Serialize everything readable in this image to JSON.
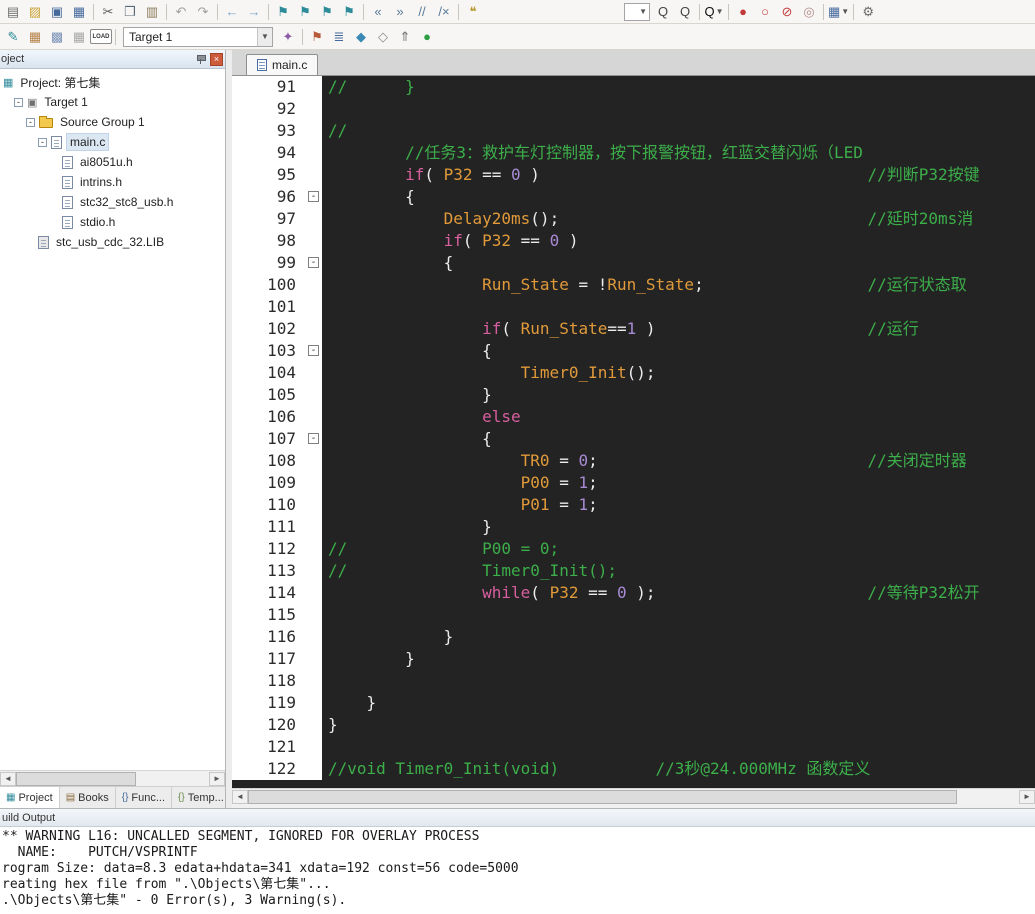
{
  "theme": {
    "editor_bg": "#232323",
    "comment": "#3cae4a",
    "keyword": "#d85f9f",
    "ident": "#e09a3a",
    "number": "#a88bd4",
    "plain": "#ececec",
    "accent": "#4a6fa5"
  },
  "toolbar_main": {
    "icons": [
      {
        "n": "new-file-icon",
        "g": "▤",
        "c": "#6e6e6e"
      },
      {
        "n": "open-file-icon",
        "g": "▨",
        "c": "#caa53d"
      },
      {
        "n": "save-icon",
        "g": "▣",
        "c": "#46699c"
      },
      {
        "n": "save-all-icon",
        "g": "▦",
        "c": "#46699c"
      },
      {
        "sep": 1
      },
      {
        "n": "cut-icon",
        "g": "✂",
        "c": "#5a5a5a"
      },
      {
        "n": "copy-icon",
        "g": "❒",
        "c": "#5a6a7a"
      },
      {
        "n": "paste-icon",
        "g": "▥",
        "c": "#8a7a5a"
      },
      {
        "sep": 1
      },
      {
        "n": "undo-icon",
        "g": "↶",
        "c": "#a0a0a0"
      },
      {
        "n": "redo-icon",
        "g": "↷",
        "c": "#a0a0a0"
      },
      {
        "sep": 1
      },
      {
        "n": "navigate-back-icon",
        "g": "←",
        "c": "#7aa7c7"
      },
      {
        "n": "navigate-forward-icon",
        "g": "→",
        "c": "#7aa7c7"
      },
      {
        "sep": 1
      },
      {
        "n": "bookmark-toggle-icon",
        "g": "⚑",
        "c": "#2e8b9a"
      },
      {
        "n": "bookmark-prev-icon",
        "g": "⚑",
        "c": "#2e8b9a"
      },
      {
        "n": "bookmark-next-icon",
        "g": "⚑",
        "c": "#2e8b9a"
      },
      {
        "n": "bookmark-clear-icon",
        "g": "⚑",
        "c": "#2e8b9a"
      },
      {
        "sep": 1
      },
      {
        "n": "outdent-icon",
        "g": "«",
        "c": "#5a7a9a"
      },
      {
        "n": "indent-icon",
        "g": "»",
        "c": "#5a7a9a"
      },
      {
        "n": "comment-selection-icon",
        "g": "//",
        "c": "#5a7a9a"
      },
      {
        "n": "uncomment-selection-icon",
        "g": "/×",
        "c": "#5a7a9a"
      },
      {
        "sep": 1
      },
      {
        "n": "insert-template-icon",
        "g": "❝",
        "c": "#b8962e"
      },
      {
        "spacer": 1
      },
      {
        "combo": 1,
        "n": "quick-search-combo"
      },
      {
        "n": "find-in-files-icon",
        "g": "Q",
        "c": "#444444"
      },
      {
        "n": "find-icon",
        "g": "Q",
        "c": "#444444"
      },
      {
        "sep": 1
      },
      {
        "n": "find-magnifier-icon",
        "g": "Q",
        "c": "#111111",
        "dd": 1
      },
      {
        "sep": 1
      },
      {
        "n": "breakpoint-toggle-icon",
        "g": "●",
        "c": "#c23b3b"
      },
      {
        "n": "breakpoint-disable-icon",
        "g": "○",
        "c": "#c23b3b"
      },
      {
        "n": "breakpoint-kill-all-icon",
        "g": "⊘",
        "c": "#c23b3b"
      },
      {
        "n": "breakpoint-enable-all-icon",
        "g": "◎",
        "c": "#b08a8a"
      },
      {
        "sep": 1
      },
      {
        "n": "window-layout-icon",
        "g": "▦",
        "c": "#46699c",
        "dd": 1
      },
      {
        "sep": 1
      },
      {
        "n": "configure-icon",
        "g": "⚙",
        "c": "#6a6a6a"
      }
    ]
  },
  "toolbar_build": {
    "left_icons": [
      {
        "n": "translate-file-icon",
        "g": "✎",
        "c": "#2e8b9a"
      },
      {
        "n": "build-icon",
        "g": "▦",
        "c": "#b5824a"
      },
      {
        "n": "rebuild-all-icon",
        "g": "▩",
        "c": "#7a93b8"
      },
      {
        "n": "batch-build-icon",
        "g": "▦",
        "c": "#a8a8a8"
      },
      {
        "n": "download-icon",
        "label": "LOAD"
      },
      {
        "sep": 1
      }
    ],
    "target": "Target 1",
    "right_icons": [
      {
        "n": "options-for-target-icon",
        "g": "✦",
        "c": "#8a5aa5"
      },
      {
        "sep": 1
      },
      {
        "n": "debug-flag-icon",
        "g": "⚑",
        "c": "#b85a3a"
      },
      {
        "n": "project-items-icon",
        "g": "≣",
        "c": "#46699c"
      },
      {
        "n": "manage-rte-icon",
        "g": "◆",
        "c": "#3a8ab5"
      },
      {
        "n": "configure-flash-icon",
        "g": "◇",
        "c": "#8a8a8a"
      },
      {
        "n": "load-direction-icon",
        "g": "⇑",
        "c": "#6a6a6a"
      },
      {
        "n": "ok-status-icon",
        "g": "●",
        "c": "#2e9e44"
      }
    ]
  },
  "project_panel": {
    "title": "oject",
    "tree": [
      {
        "label": "Project: 第七集",
        "indent": 3,
        "icon": "workspace",
        "expander": false,
        "selected": false
      },
      {
        "label": "Target 1",
        "indent": 14,
        "icon": "target",
        "expander": true,
        "selected": false
      },
      {
        "label": "Source Group 1",
        "indent": 26,
        "icon": "folder",
        "expander": true,
        "selected": false
      },
      {
        "label": "main.c",
        "indent": 38,
        "icon": "source",
        "expander": true,
        "selected": true
      },
      {
        "label": "ai8051u.h",
        "indent": 62,
        "icon": "header",
        "expander": false,
        "selected": false
      },
      {
        "label": "intrins.h",
        "indent": 62,
        "icon": "header",
        "expander": false,
        "selected": false
      },
      {
        "label": "stc32_stc8_usb.h",
        "indent": 62,
        "icon": "header",
        "expander": false,
        "selected": false
      },
      {
        "label": "stdio.h",
        "indent": 62,
        "icon": "header",
        "expander": false,
        "selected": false
      },
      {
        "label": "stc_usb_cdc_32.LIB",
        "indent": 38,
        "icon": "lib",
        "expander": false,
        "selected": false
      }
    ],
    "tabs": [
      {
        "label": "Project",
        "icon_glyph": "▦",
        "icon_color": "#2e8b9a",
        "active": true
      },
      {
        "label": "Books",
        "icon_glyph": "▤",
        "icon_color": "#8a6a3a",
        "active": false
      },
      {
        "label": "Func...",
        "icon_glyph": "{}",
        "icon_color": "#46699c",
        "active": false
      },
      {
        "label": "Temp...",
        "icon_glyph": "{}",
        "icon_color": "#6a8a4a",
        "active": false
      }
    ]
  },
  "editor": {
    "tab": "main.c",
    "default_tail_col": 56,
    "lines": [
      {
        "n": 91,
        "segs": [
          [
            "c",
            "//      }"
          ]
        ]
      },
      {
        "n": 92,
        "segs": []
      },
      {
        "n": 93,
        "segs": [
          [
            "c",
            "//"
          ]
        ]
      },
      {
        "n": 94,
        "segs": [
          [
            "c",
            "        //任务3：救护车灯控制器，按下报警按钮，红蓝交替闪烁（LED"
          ]
        ]
      },
      {
        "n": 95,
        "segs": [
          [
            "p",
            "        "
          ],
          [
            "k",
            "if"
          ],
          [
            "p",
            "( "
          ],
          [
            "i",
            "P32"
          ],
          [
            "p",
            " == "
          ],
          [
            "n",
            "0"
          ],
          [
            "p",
            " )"
          ]
        ],
        "tail": "//判断P32按键"
      },
      {
        "n": 96,
        "segs": [
          [
            "p",
            "        {"
          ]
        ],
        "fold": true
      },
      {
        "n": 97,
        "segs": [
          [
            "p",
            "            "
          ],
          [
            "i",
            "Delay20ms"
          ],
          [
            "p",
            "();"
          ]
        ],
        "tail": "//延时20ms消"
      },
      {
        "n": 98,
        "segs": [
          [
            "p",
            "            "
          ],
          [
            "k",
            "if"
          ],
          [
            "p",
            "( "
          ],
          [
            "i",
            "P32"
          ],
          [
            "p",
            " == "
          ],
          [
            "n",
            "0"
          ],
          [
            "p",
            " )"
          ]
        ]
      },
      {
        "n": 99,
        "segs": [
          [
            "p",
            "            {"
          ]
        ],
        "fold": true
      },
      {
        "n": 100,
        "segs": [
          [
            "p",
            "                "
          ],
          [
            "i",
            "Run_State"
          ],
          [
            "p",
            " = !"
          ],
          [
            "i",
            "Run_State"
          ],
          [
            "p",
            ";"
          ]
        ],
        "tail": "//运行状态取"
      },
      {
        "n": 101,
        "segs": []
      },
      {
        "n": 102,
        "segs": [
          [
            "p",
            "                "
          ],
          [
            "k",
            "if"
          ],
          [
            "p",
            "( "
          ],
          [
            "i",
            "Run_State"
          ],
          [
            "p",
            "=="
          ],
          [
            "n",
            "1"
          ],
          [
            "p",
            " )"
          ]
        ],
        "tail": "//运行"
      },
      {
        "n": 103,
        "segs": [
          [
            "p",
            "                {"
          ]
        ],
        "fold": true
      },
      {
        "n": 104,
        "segs": [
          [
            "p",
            "                    "
          ],
          [
            "i",
            "Timer0_Init"
          ],
          [
            "p",
            "();"
          ]
        ]
      },
      {
        "n": 105,
        "segs": [
          [
            "p",
            "                }"
          ]
        ]
      },
      {
        "n": 106,
        "segs": [
          [
            "p",
            "                "
          ],
          [
            "k",
            "else"
          ]
        ]
      },
      {
        "n": 107,
        "segs": [
          [
            "p",
            "                {"
          ]
        ],
        "fold": true
      },
      {
        "n": 108,
        "segs": [
          [
            "p",
            "                    "
          ],
          [
            "i",
            "TR0"
          ],
          [
            "p",
            " = "
          ],
          [
            "n",
            "0"
          ],
          [
            "p",
            ";"
          ]
        ],
        "tail": "//关闭定时器"
      },
      {
        "n": 109,
        "segs": [
          [
            "p",
            "                    "
          ],
          [
            "i",
            "P00"
          ],
          [
            "p",
            " = "
          ],
          [
            "n",
            "1"
          ],
          [
            "p",
            ";"
          ]
        ]
      },
      {
        "n": 110,
        "segs": [
          [
            "p",
            "                    "
          ],
          [
            "i",
            "P01"
          ],
          [
            "p",
            " = "
          ],
          [
            "n",
            "1"
          ],
          [
            "p",
            ";"
          ]
        ]
      },
      {
        "n": 111,
        "segs": [
          [
            "p",
            "                }"
          ]
        ]
      },
      {
        "n": 112,
        "segs": [
          [
            "c",
            "//              P00 = 0;"
          ]
        ]
      },
      {
        "n": 113,
        "segs": [
          [
            "c",
            "//              Timer0_Init();"
          ]
        ]
      },
      {
        "n": 114,
        "segs": [
          [
            "p",
            "                "
          ],
          [
            "k",
            "while"
          ],
          [
            "p",
            "( "
          ],
          [
            "i",
            "P32"
          ],
          [
            "p",
            " == "
          ],
          [
            "n",
            "0"
          ],
          [
            "p",
            " );"
          ]
        ],
        "tail": "//等待P32松开"
      },
      {
        "n": 115,
        "segs": []
      },
      {
        "n": 116,
        "segs": [
          [
            "p",
            "            }"
          ]
        ]
      },
      {
        "n": 117,
        "segs": [
          [
            "p",
            "        }"
          ]
        ]
      },
      {
        "n": 118,
        "segs": []
      },
      {
        "n": 119,
        "segs": [
          [
            "p",
            "    }"
          ]
        ]
      },
      {
        "n": 120,
        "segs": [
          [
            "p",
            "}"
          ]
        ]
      },
      {
        "n": 121,
        "segs": []
      },
      {
        "n": 122,
        "segs": [
          [
            "c",
            "//void Timer0_Init(void)"
          ]
        ],
        "tail": "//3秒@24.000MHz 函数定义",
        "tailcol": 34
      }
    ]
  },
  "build_output": {
    "title": "uild Output",
    "lines": [
      "** WARNING L16: UNCALLED SEGMENT, IGNORED FOR OVERLAY PROCESS",
      "  NAME:    PUTCH/VSPRINTF",
      "rogram Size: data=8.3 edata+hdata=341 xdata=192 const=56 code=5000",
      "reating hex file from \".\\Objects\\第七集\"...",
      ".\\Objects\\第七集\" - 0 Error(s), 3 Warning(s)."
    ]
  }
}
